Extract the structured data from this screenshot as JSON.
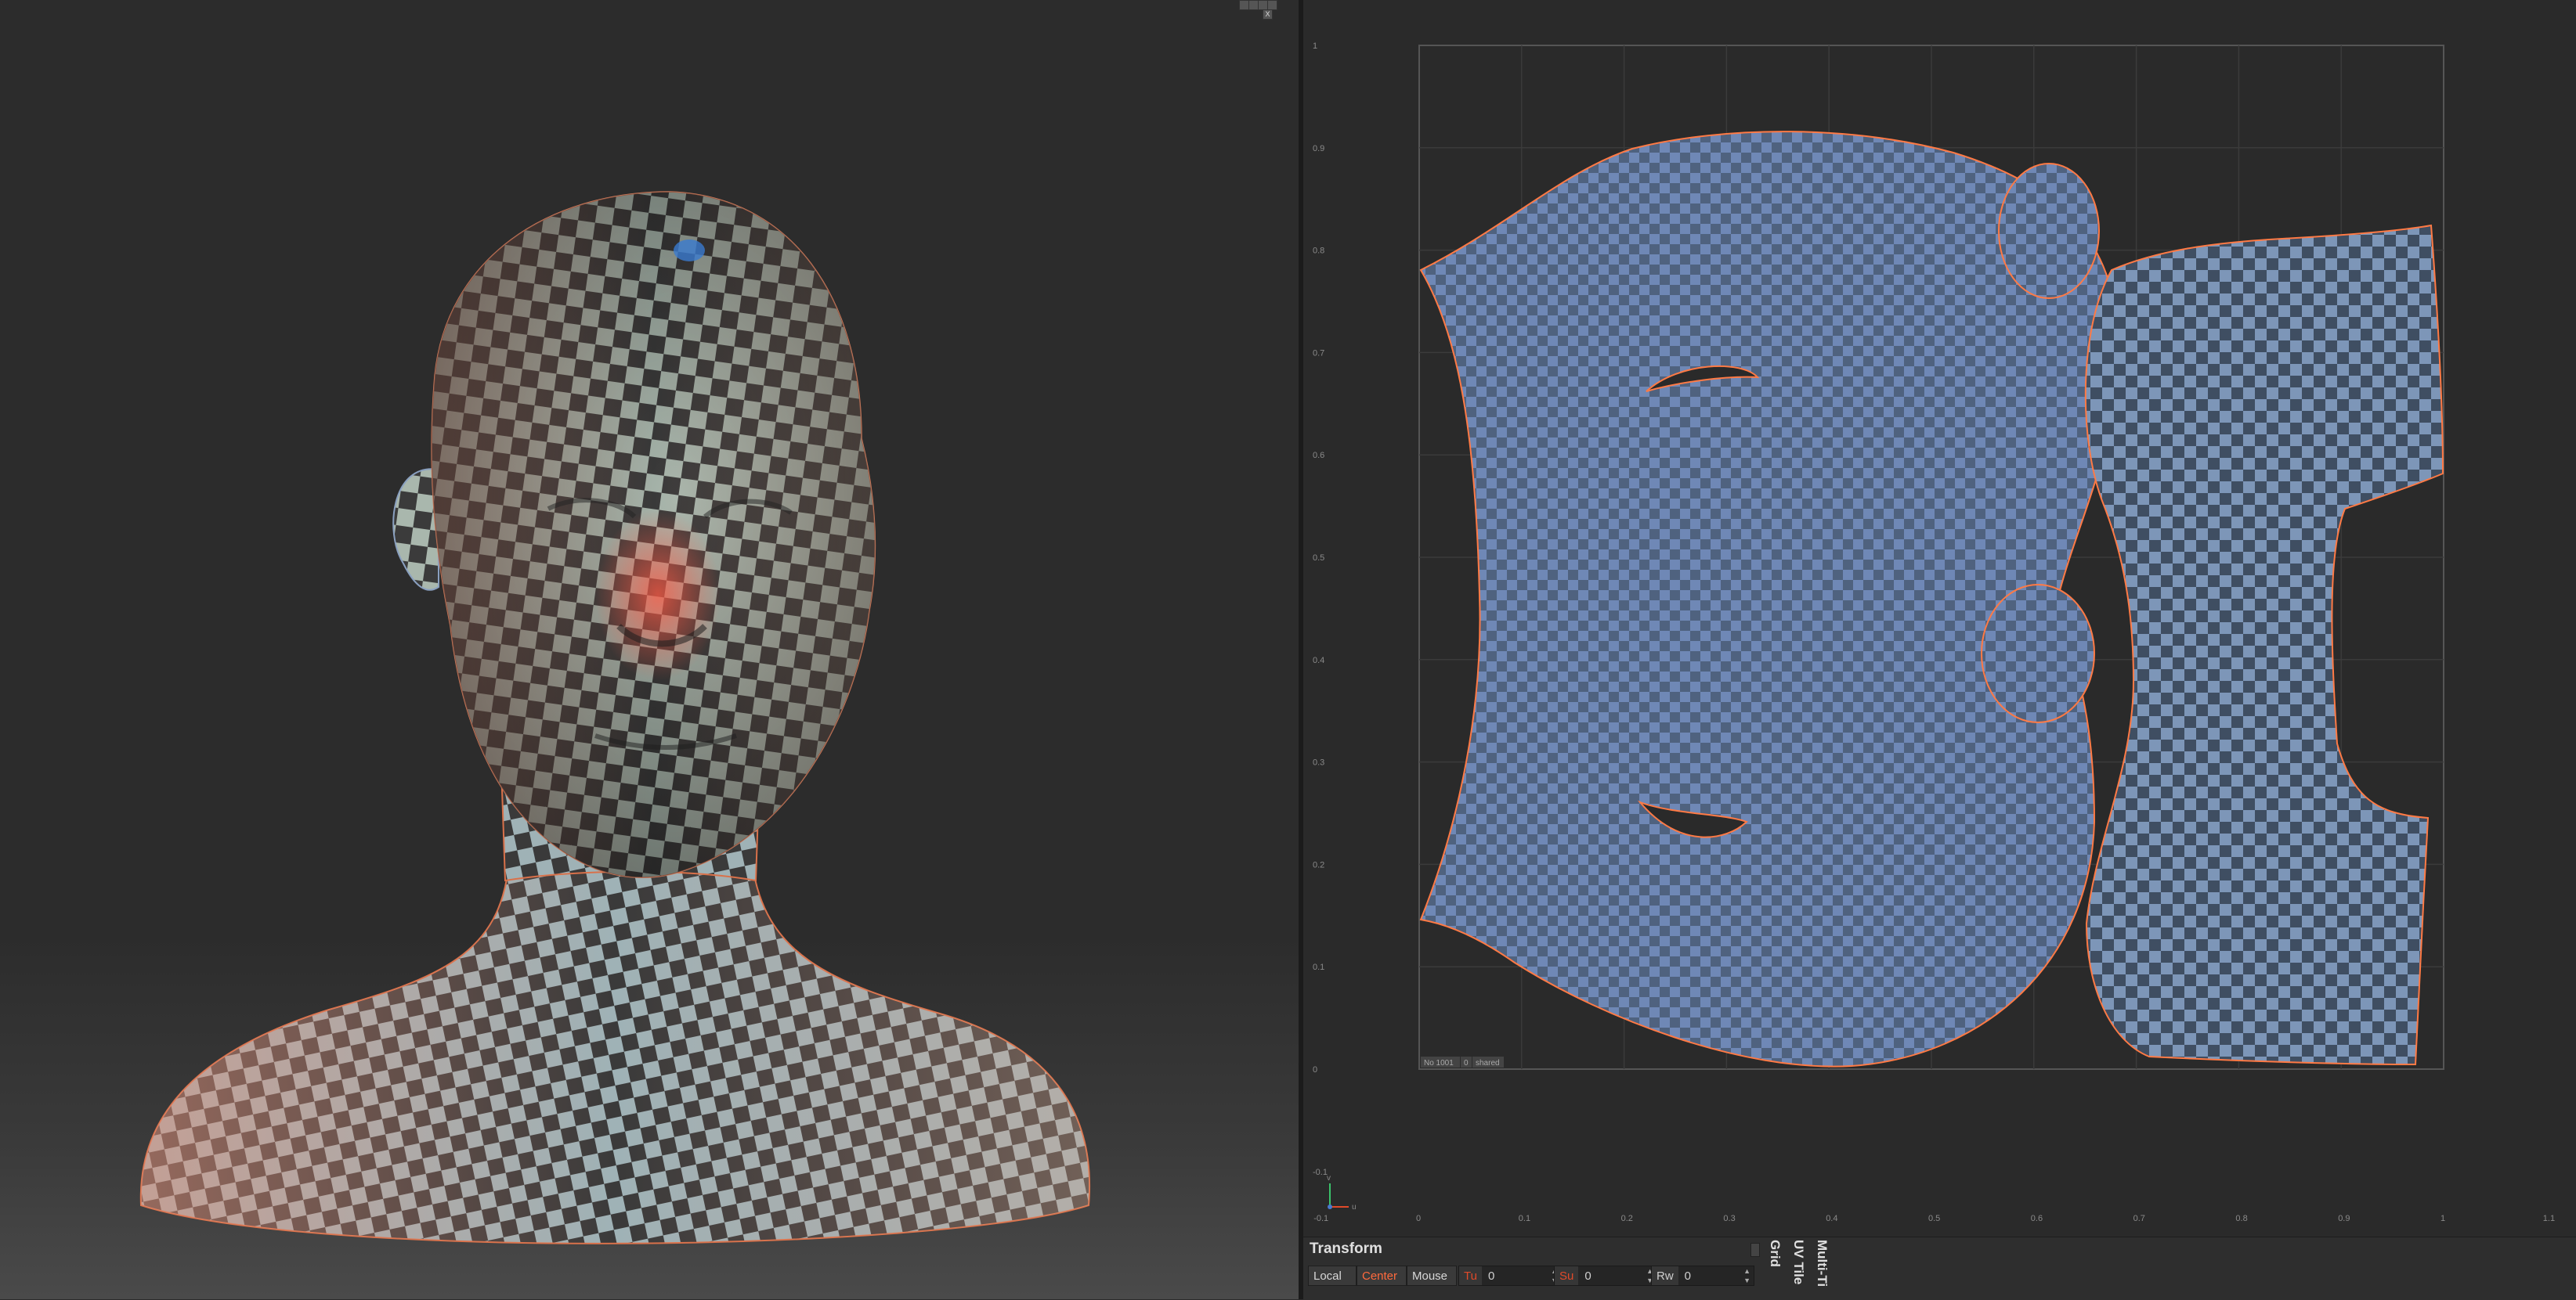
{
  "app": {
    "viewport_controls": [
      "",
      "",
      "",
      "",
      "X"
    ]
  },
  "uv_axis": {
    "v_ticks": [
      "1",
      "0.9",
      "0.8",
      "0.7",
      "0.6",
      "0.5",
      "0.4",
      "0.3",
      "0.2",
      "0.1",
      "0",
      "-0.1"
    ],
    "u_ticks": [
      "-0.1",
      "0",
      "0.1",
      "0.2",
      "0.3",
      "0.4",
      "0.5",
      "0.6",
      "0.7",
      "0.8",
      "0.9",
      "1",
      "1.1"
    ],
    "gizmo_u": "u",
    "gizmo_v": "v",
    "tile_info": [
      "No 1001",
      "0",
      "shared"
    ]
  },
  "colors": {
    "background": "#2b2b2b",
    "uv_shell_fill": "#6c86b4",
    "uv_shell_edge": "#ff7a45",
    "accent": "#ff6a3d"
  },
  "transform_panel": {
    "title": "Transform",
    "local_label": "Local",
    "center_label": "Center",
    "mouse_label": "Mouse",
    "tu_label": "Tu",
    "tu_value": "0",
    "su_label": "Su",
    "su_value": "0",
    "rw_label": "Rw",
    "rw_value": "0"
  },
  "side_tabs": [
    "Grid",
    "UV Tile",
    "Multi-Ti"
  ]
}
